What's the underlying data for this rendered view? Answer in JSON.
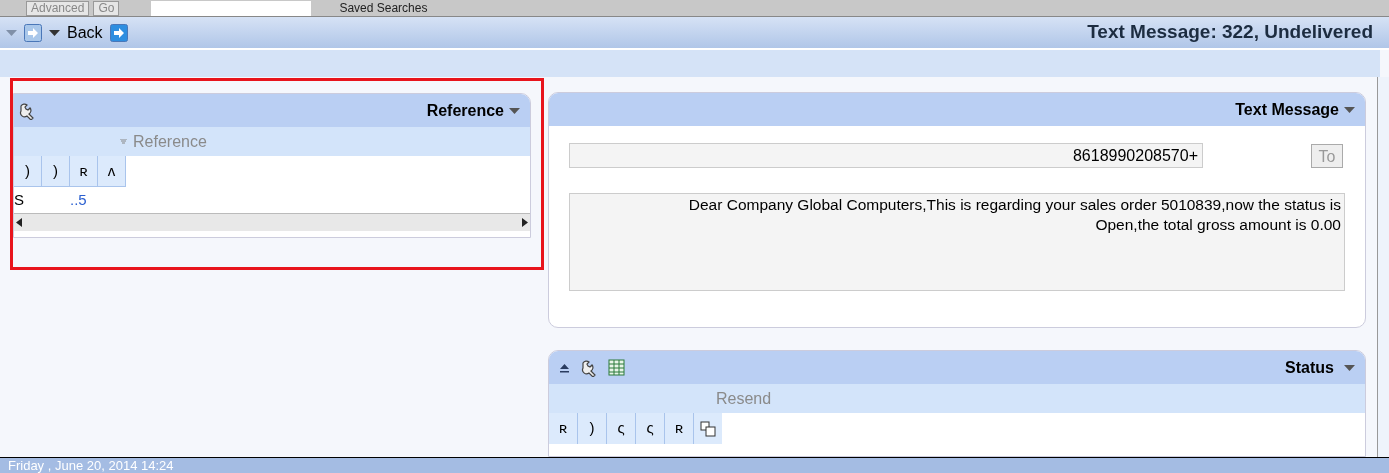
{
  "toolbar": {
    "buttons": [
      "Advanced",
      "Go"
    ],
    "saved_searches": "Saved Searches"
  },
  "header": {
    "back": "Back",
    "title": "Text Message: 322, Undelivered"
  },
  "reference_panel": {
    "title": "Reference",
    "action": "Reference",
    "columns": [
      ")",
      ")",
      "ʀ",
      "ʌ"
    ],
    "rows": [
      {
        "column_1": "S",
        "column_3": "..5"
      }
    ]
  },
  "message_panel": {
    "title": "Text Message",
    "recipient": "8618990208570+",
    "to_button": "To",
    "body": "Dear Company Global Computers,This is regarding your sales order 5010839,now the status is Open,the total gross amount is 0.00"
  },
  "status_panel": {
    "title": "Status",
    "action": "Resend",
    "columns": [
      "ʀ",
      ")",
      "ς",
      "ς",
      "ʀ"
    ]
  },
  "status_bar": "Friday , June 20, 2014 14:24"
}
